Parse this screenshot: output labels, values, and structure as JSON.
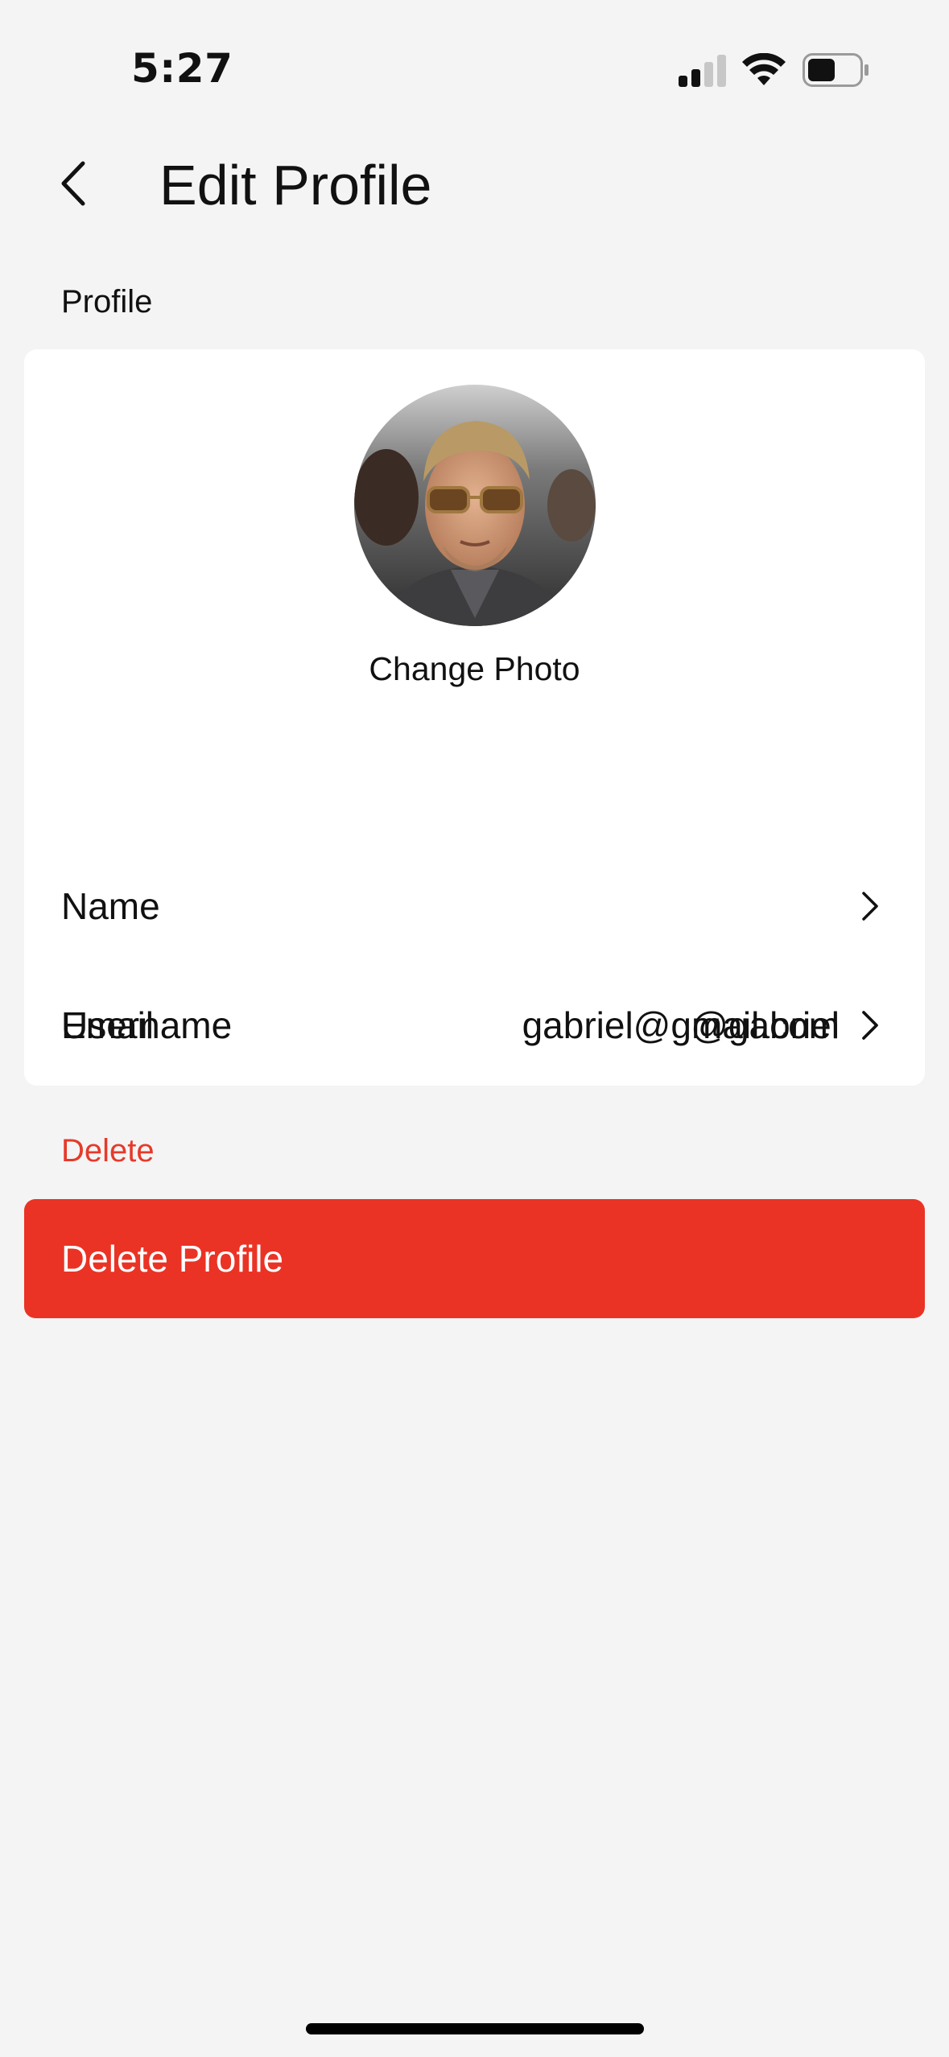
{
  "status_bar": {
    "time": "5:27",
    "signal_icon": "cellular-signal-icon",
    "wifi_icon": "wifi-icon",
    "battery_icon": "battery-icon",
    "battery_level": 0.45
  },
  "header": {
    "back_icon": "chevron-left-icon",
    "title": "Edit Profile"
  },
  "profile_section": {
    "label": "Profile",
    "avatar_icon": "profile-photo",
    "change_photo_label": "Change Photo",
    "rows": [
      {
        "label": "Name",
        "value": ""
      },
      {
        "label": "Username",
        "value": "@gabriel"
      },
      {
        "label": "Email",
        "value": "gabriel@gmail.com"
      }
    ]
  },
  "delete_section": {
    "label": "Delete",
    "button_label": "Delete Profile"
  },
  "colors": {
    "background": "#f4f4f4",
    "card": "#ffffff",
    "danger": "#ea3325",
    "danger_text": "#e53a2a",
    "text": "#111111"
  }
}
